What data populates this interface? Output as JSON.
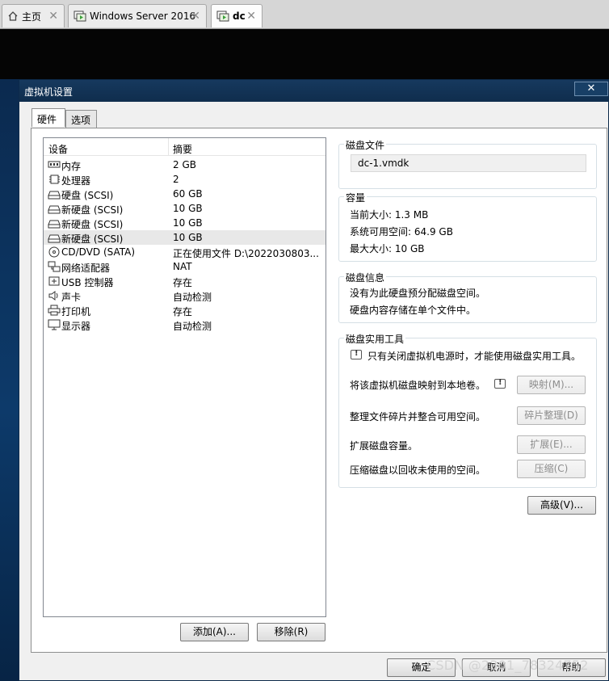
{
  "app_tabs": [
    {
      "label": "主页",
      "icon": "home-icon"
    },
    {
      "label": "Windows Server 2016",
      "icon": "vm-icon"
    },
    {
      "label": "dc",
      "icon": "vm-running-icon"
    }
  ],
  "dialog": {
    "title": "虚拟机设置",
    "close": "✕",
    "tabs": [
      "硬件",
      "选项"
    ],
    "device_list": {
      "headers": {
        "device": "设备",
        "summary": "摘要"
      },
      "rows": [
        {
          "icon": "memory-icon",
          "name": "内存",
          "summary": "2 GB"
        },
        {
          "icon": "processor-icon",
          "name": "处理器",
          "summary": "2"
        },
        {
          "icon": "harddisk-icon",
          "name": "硬盘 (SCSI)",
          "summary": "60 GB"
        },
        {
          "icon": "harddisk-icon",
          "name": "新硬盘 (SCSI)",
          "summary": "10 GB"
        },
        {
          "icon": "harddisk-icon",
          "name": "新硬盘 (SCSI)",
          "summary": "10 GB"
        },
        {
          "icon": "harddisk-icon",
          "name": "新硬盘 (SCSI)",
          "summary": "10 GB",
          "selected": true
        },
        {
          "icon": "cdrom-icon",
          "name": "CD/DVD (SATA)",
          "summary": "正在使用文件 D:\\2022030803..."
        },
        {
          "icon": "network-icon",
          "name": "网络适配器",
          "summary": "NAT"
        },
        {
          "icon": "usb-icon",
          "name": "USB 控制器",
          "summary": "存在"
        },
        {
          "icon": "sound-icon",
          "name": "声卡",
          "summary": "自动检测"
        },
        {
          "icon": "printer-icon",
          "name": "打印机",
          "summary": "存在"
        },
        {
          "icon": "display-icon",
          "name": "显示器",
          "summary": "自动检测"
        }
      ],
      "add_button": "添加(A)...",
      "remove_button": "移除(R)"
    },
    "disk_file": {
      "title": "磁盘文件",
      "value": "dc-1.vmdk"
    },
    "capacity": {
      "title": "容量",
      "current": "当前大小: 1.3 MB",
      "available": "系统可用空间: 64.9 GB",
      "max": "最大大小: 10 GB"
    },
    "disk_info": {
      "title": "磁盘信息",
      "line1": "没有为此硬盘预分配磁盘空间。",
      "line2": "硬盘内容存储在单个文件中。"
    },
    "disk_tools": {
      "title": "磁盘实用工具",
      "note": "只有关闭虚拟机电源时，才能使用磁盘实用工具。",
      "map_label": "将该虚拟机磁盘映射到本地卷。",
      "map_button": "映射(M)...",
      "defrag_label": "整理文件碎片并整合可用空间。",
      "defrag_button": "碎片整理(D)",
      "expand_label": "扩展磁盘容量。",
      "expand_button": "扩展(E)...",
      "compact_label": "压缩磁盘以回收未使用的空间。",
      "compact_button": "压缩(C)"
    },
    "advanced_button": "高级(V)...",
    "ok_button": "确定",
    "cancel_button": "取消",
    "help_button": "帮助"
  },
  "watermark": "CSDN @2301_78324752"
}
